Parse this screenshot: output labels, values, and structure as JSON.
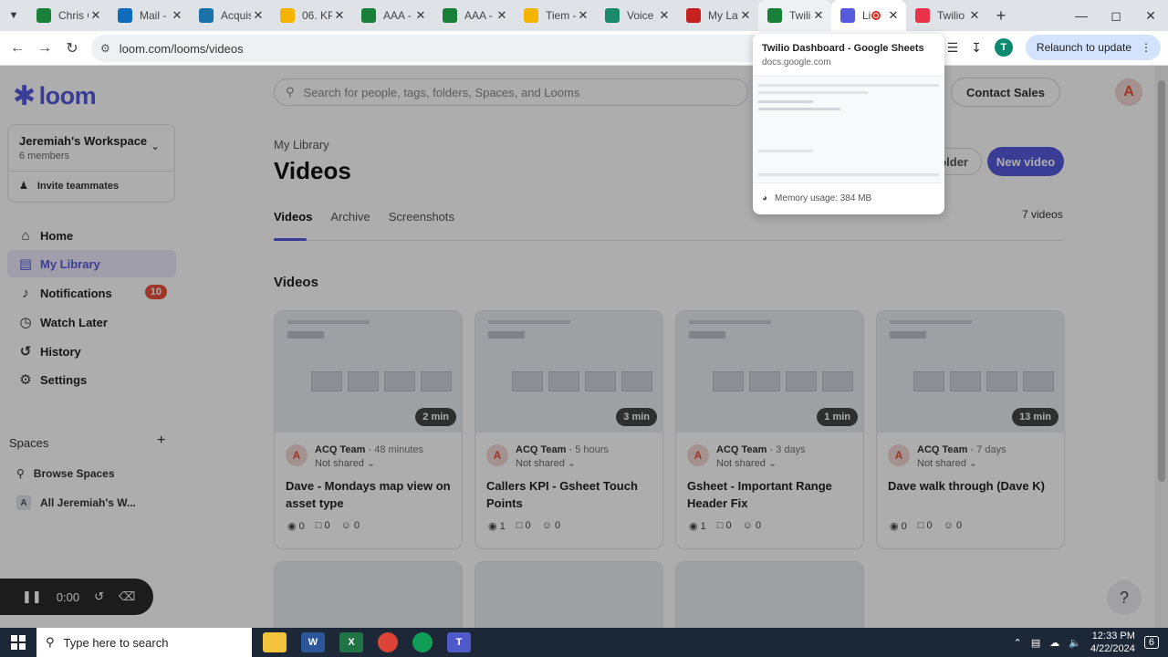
{
  "browser": {
    "tabs": [
      {
        "title": "Chris C",
        "icon": "sheets-icon",
        "color": "#188038"
      },
      {
        "title": "Mail -",
        "icon": "outlook-icon",
        "color": "#0f6cbd"
      },
      {
        "title": "Acquis",
        "icon": "app-icon",
        "color": "#1a73a8"
      },
      {
        "title": "06. KP",
        "icon": "drive-icon",
        "color": "#f4b400"
      },
      {
        "title": "AAA -",
        "icon": "sheets-icon",
        "color": "#188038"
      },
      {
        "title": "AAA -",
        "icon": "sheets-icon",
        "color": "#188038"
      },
      {
        "title": "Tiem -",
        "icon": "drive-icon",
        "color": "#f4b400"
      },
      {
        "title": "Voice",
        "icon": "phone-icon",
        "color": "#1a8a6a"
      },
      {
        "title": "My La",
        "icon": "app-icon",
        "color": "#c5221f"
      },
      {
        "title": "Twilio",
        "icon": "sheets-icon",
        "color": "#188038"
      },
      {
        "title": "Lib",
        "icon": "loom-icon",
        "color": "#565add"
      },
      {
        "title": "Twilio",
        "icon": "twilio-icon",
        "color": "#e8334a"
      }
    ],
    "url": "loom.com/looms/videos",
    "relaunch": "Relaunch to update",
    "profile_initial": "T"
  },
  "hovercard": {
    "title": "Twilio Dashboard - Google Sheets",
    "url": "docs.google.com",
    "memory": "Memory usage: 384 MB"
  },
  "sidebar": {
    "logo": "loom",
    "workspace_name": "Jeremiah's Workspace",
    "workspace_members": "6 members",
    "invite": "Invite teammates",
    "items": [
      {
        "label": "Home",
        "icon": "home-icon"
      },
      {
        "label": "My Library",
        "icon": "library-icon"
      },
      {
        "label": "Notifications",
        "icon": "bell-icon",
        "badge": "10"
      },
      {
        "label": "Watch Later",
        "icon": "clock-icon"
      },
      {
        "label": "History",
        "icon": "history-icon"
      },
      {
        "label": "Settings",
        "icon": "gear-icon"
      }
    ],
    "spaces_heading": "Spaces",
    "browse_spaces": "Browse Spaces",
    "space_item": "All Jeremiah's W...",
    "space_initial": "A"
  },
  "main": {
    "search_placeholder": "Search for people, tags, folders, Spaces, and Looms",
    "contact_sales": "Contact Sales",
    "user_initial": "A",
    "breadcrumb": "My Library",
    "title": "Videos",
    "new_folder": "New folder",
    "new_video": "New video",
    "tabs": [
      "Videos",
      "Archive",
      "Screenshots"
    ],
    "count": "7 videos",
    "section": "Videos"
  },
  "videos": [
    {
      "author": "ACQ Team",
      "age": "48 minutes",
      "shared": "Not shared",
      "title": "Dave - Mondays map view on asset type",
      "duration": "2 min",
      "views": "0",
      "comments": "0",
      "reactions": "0"
    },
    {
      "author": "ACQ Team",
      "age": "5 hours",
      "shared": "Not shared",
      "title": "Callers KPI - Gsheet Touch Points",
      "duration": "3 min",
      "views": "1",
      "comments": "0",
      "reactions": "0"
    },
    {
      "author": "ACQ Team",
      "age": "3 days",
      "shared": "Not shared",
      "title": "Gsheet - Important Range Header Fix",
      "duration": "1 min",
      "views": "1",
      "comments": "0",
      "reactions": "0"
    },
    {
      "author": "ACQ Team",
      "age": "7 days",
      "shared": "Not shared",
      "title": "Dave walk through (Dave K)",
      "duration": "13 min",
      "views": "0",
      "comments": "0",
      "reactions": "0"
    }
  ],
  "author_initial": "A",
  "recorder": {
    "time": "0:00"
  },
  "taskbar": {
    "search_placeholder": "Type here to search",
    "time": "12:33 PM",
    "date": "4/22/2024",
    "notif_count": "6"
  }
}
